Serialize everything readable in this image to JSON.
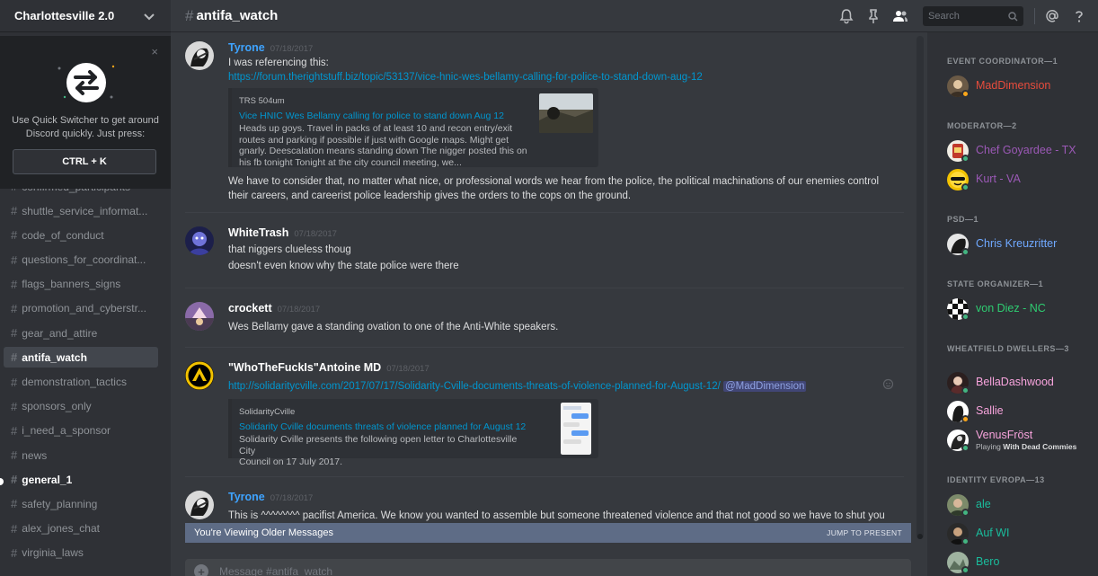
{
  "server": {
    "name": "Charlottesville 2.0"
  },
  "quick_switcher": {
    "text": "Use Quick Switcher to get around Discord quickly. Just press:",
    "shortcut": "CTRL + K",
    "close": "×"
  },
  "channels": [
    {
      "name": "confirmed_participants",
      "state": "normal"
    },
    {
      "name": "shuttle_service_informat...",
      "state": "normal"
    },
    {
      "name": "code_of_conduct",
      "state": "normal"
    },
    {
      "name": "questions_for_coordinat...",
      "state": "normal"
    },
    {
      "name": "flags_banners_signs",
      "state": "normal"
    },
    {
      "name": "promotion_and_cyberstr...",
      "state": "normal"
    },
    {
      "name": "gear_and_attire",
      "state": "normal"
    },
    {
      "name": "antifa_watch",
      "state": "active"
    },
    {
      "name": "demonstration_tactics",
      "state": "normal"
    },
    {
      "name": "sponsors_only",
      "state": "normal"
    },
    {
      "name": "i_need_a_sponsor",
      "state": "normal"
    },
    {
      "name": "news",
      "state": "normal"
    },
    {
      "name": "general_1",
      "state": "unread"
    },
    {
      "name": "safety_planning",
      "state": "normal"
    },
    {
      "name": "alex_jones_chat",
      "state": "normal"
    },
    {
      "name": "virginia_laws",
      "state": "normal"
    }
  ],
  "header": {
    "hash": "#",
    "channel": "antifa_watch",
    "search_placeholder": "Search"
  },
  "messages": [
    {
      "author": "Tyrone",
      "timestamp": "07/18/2017",
      "author_color": "#3ea3ff",
      "lines": [
        "I was referencing this:"
      ],
      "link": "https://forum.therightstuff.biz/topic/53137/vice-hnic-wes-bellamy-calling-for-police-to-stand-down-aug-12",
      "embed": {
        "provider": "TRS 504um",
        "title": "Vice HNIC Wes Bellamy calling for police to stand down Aug 12",
        "description": [
          "Heads up goys. Travel in packs of at least 10 and recon entry/exit",
          "routes and parking if possible if just with Google maps. Might get",
          "gnarly. Deescalation means standing down The nigger posted this on",
          "his fb tonight Tonight at the city council meeting, we..."
        ]
      },
      "after_lines": [
        "We have to consider that, no matter what nice, or professional words we hear from the police, the political machinations of our enemies control",
        "their careers, and careerist police leadership gives the orders to the cops on the ground."
      ]
    },
    {
      "author": "WhiteTrash",
      "timestamp": "07/18/2017",
      "author_color": "#ffffff",
      "lines": [
        "that niggers clueless thoug",
        "doesn't even know why the state police were there"
      ]
    },
    {
      "author": "crockett",
      "timestamp": "07/18/2017",
      "author_color": "#ffffff",
      "lines": [
        "Wes Bellamy gave a standing ovation to one of the Anti-White speakers."
      ]
    },
    {
      "author": "\"WhoTheFuckIs\"Antoine MD",
      "timestamp": "07/18/2017",
      "author_color": "#ffffff",
      "link": "http://solidaritycville.com/2017/07/17/Solidarity-Cville-documents-threats-of-violence-planned-for-August-12/",
      "mention": "@MadDimension",
      "embed": {
        "provider": "SolidarityCville",
        "title": "Solidarity Cville documents threats of violence planned for August 12",
        "description": [
          "Solidarity Cville presents the following open letter to Charlottesville City",
          "Council on 17 July 2017."
        ]
      }
    },
    {
      "author": "Tyrone",
      "timestamp": "07/18/2017",
      "author_color": "#3ea3ff",
      "lines": [
        "This is ^^^^^^^^ pacifist America. We know you wanted to assemble but someone threatened violence and that not good so we have to shut you"
      ]
    }
  ],
  "older_banner": {
    "text": "You're Viewing Older Messages",
    "jump": "JUMP TO PRESENT"
  },
  "composer": {
    "placeholder": "Message #antifa_watch",
    "plus": "+"
  },
  "member_groups": [
    {
      "role": "EVENT COORDINATOR—1",
      "members": [
        {
          "name": "MadDimension",
          "color": "#e74c3c",
          "status": "idle"
        }
      ]
    },
    {
      "role": "MODERATOR—2",
      "members": [
        {
          "name": "Chef Goyardee - TX",
          "color": "#9b59b6",
          "status": "online"
        },
        {
          "name": "Kurt - VA",
          "color": "#9b59b6",
          "status": "online"
        }
      ]
    },
    {
      "role": "PSD—1",
      "members": [
        {
          "name": "Chris Kreuzritter",
          "color": "#6fa8ff",
          "status": "online"
        }
      ]
    },
    {
      "role": "STATE ORGANIZER—1",
      "members": [
        {
          "name": "von Diez - NC",
          "color": "#2ecc71",
          "status": "online"
        }
      ]
    },
    {
      "role": "WHEATFIELD DWELLERS—3",
      "members": [
        {
          "name": "BellaDashwood",
          "color": "#f7a3dc",
          "status": "online"
        },
        {
          "name": "Sallie",
          "color": "#f7a3dc",
          "status": "idle"
        },
        {
          "name": "VenusFröst",
          "color": "#f7a3dc",
          "status": "online",
          "activity_prefix": "Playing",
          "activity": "With Dead Commies"
        }
      ]
    },
    {
      "role": "IDENTITY EVROPA—13",
      "members": [
        {
          "name": "ale",
          "color": "#1abc9c",
          "status": "online"
        },
        {
          "name": "Auf WI",
          "color": "#1abc9c",
          "status": "online"
        },
        {
          "name": "Bero",
          "color": "#1abc9c",
          "status": "online"
        }
      ]
    }
  ],
  "colors": {
    "background": "#36393e",
    "sidebar": "#2f3136",
    "link": "#0096cf",
    "online": "#43b581",
    "idle": "#faa61a"
  },
  "icons": [
    "chevron-down-icon",
    "bell-icon",
    "pin-icon",
    "members-icon",
    "search-icon",
    "at-icon",
    "help-icon",
    "swap-arrows-icon",
    "close-icon"
  ]
}
